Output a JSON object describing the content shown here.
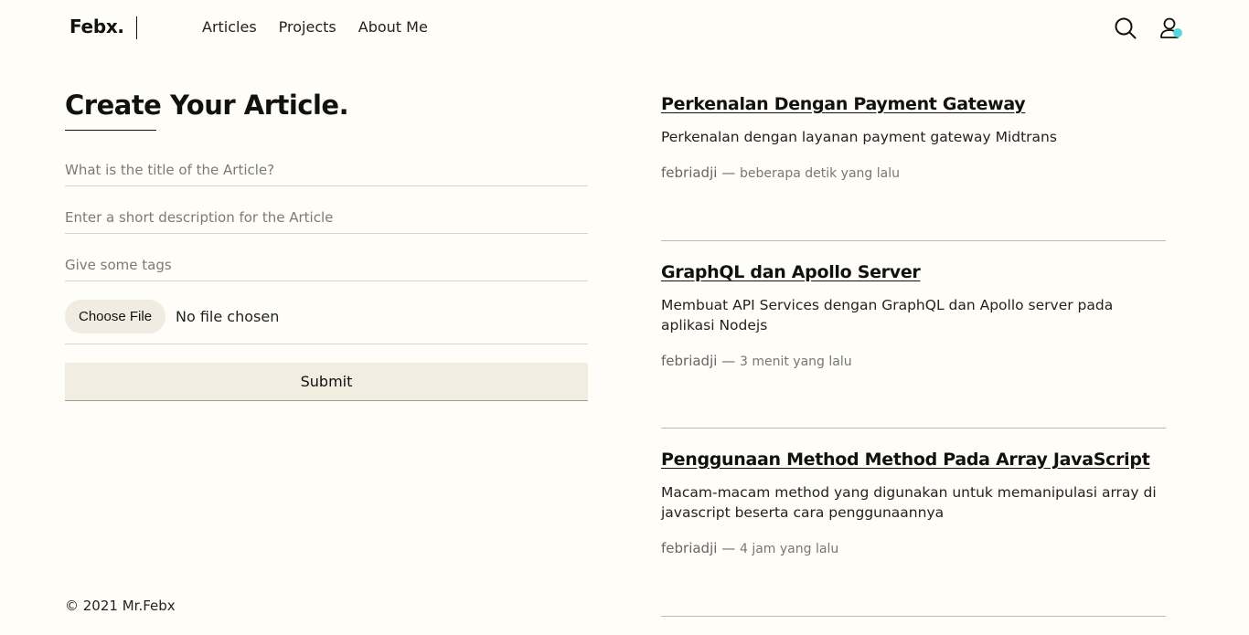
{
  "header": {
    "logo": "Febx.",
    "nav": [
      {
        "label": "Articles"
      },
      {
        "label": "Projects"
      },
      {
        "label": "About Me"
      }
    ],
    "icons": [
      "search-icon",
      "user-icon"
    ],
    "status_dot_color": "#58d6dd"
  },
  "form": {
    "heading": "Create Your Article.",
    "title_placeholder": "What is the title of the Article?",
    "description_placeholder": "Enter a short description for the Article",
    "tags_placeholder": "Give some tags",
    "choose_file_label": "Choose File",
    "file_status": "No file chosen",
    "submit_label": "Submit"
  },
  "articles": [
    {
      "title": "Perkenalan Dengan Payment Gateway",
      "description": "Perkenalan dengan layanan payment gateway Midtrans",
      "author": "febriadji",
      "time": "beberapa detik yang lalu"
    },
    {
      "title": "GraphQL dan Apollo Server",
      "description": "Membuat API Services dengan GraphQL dan Apollo server pada aplikasi Nodejs",
      "author": "febriadji",
      "time": "3 menit yang lalu"
    },
    {
      "title": "Penggunaan Method Method Pada Array JavaScript",
      "description": "Macam-macam method yang digunakan untuk memanipulasi array di javascript beserta cara penggunaannya",
      "author": "febriadji",
      "time": "4 jam yang lalu"
    }
  ],
  "footer": {
    "copyright": "© 2021 Mr.Febx"
  }
}
